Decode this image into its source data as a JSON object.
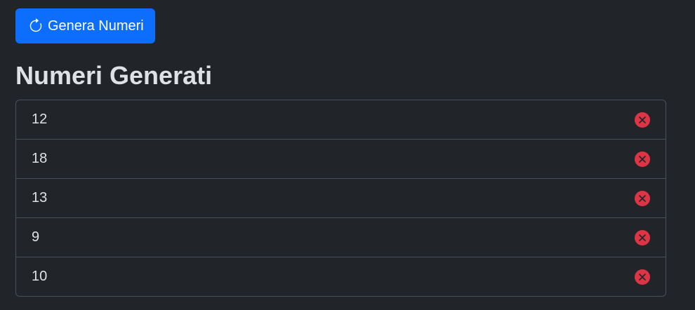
{
  "toolbar": {
    "generate_label": "Genera Numeri",
    "generate_icon": "refresh-icon"
  },
  "main": {
    "title": "Numeri Generati",
    "numbers": [
      "12",
      "18",
      "13",
      "9",
      "10"
    ],
    "remove_icon": "x-circle-icon"
  },
  "colors": {
    "background": "#212529",
    "primary": "#0d6efd",
    "danger": "#dc3545",
    "border": "#495057",
    "text": "#dee2e6"
  }
}
